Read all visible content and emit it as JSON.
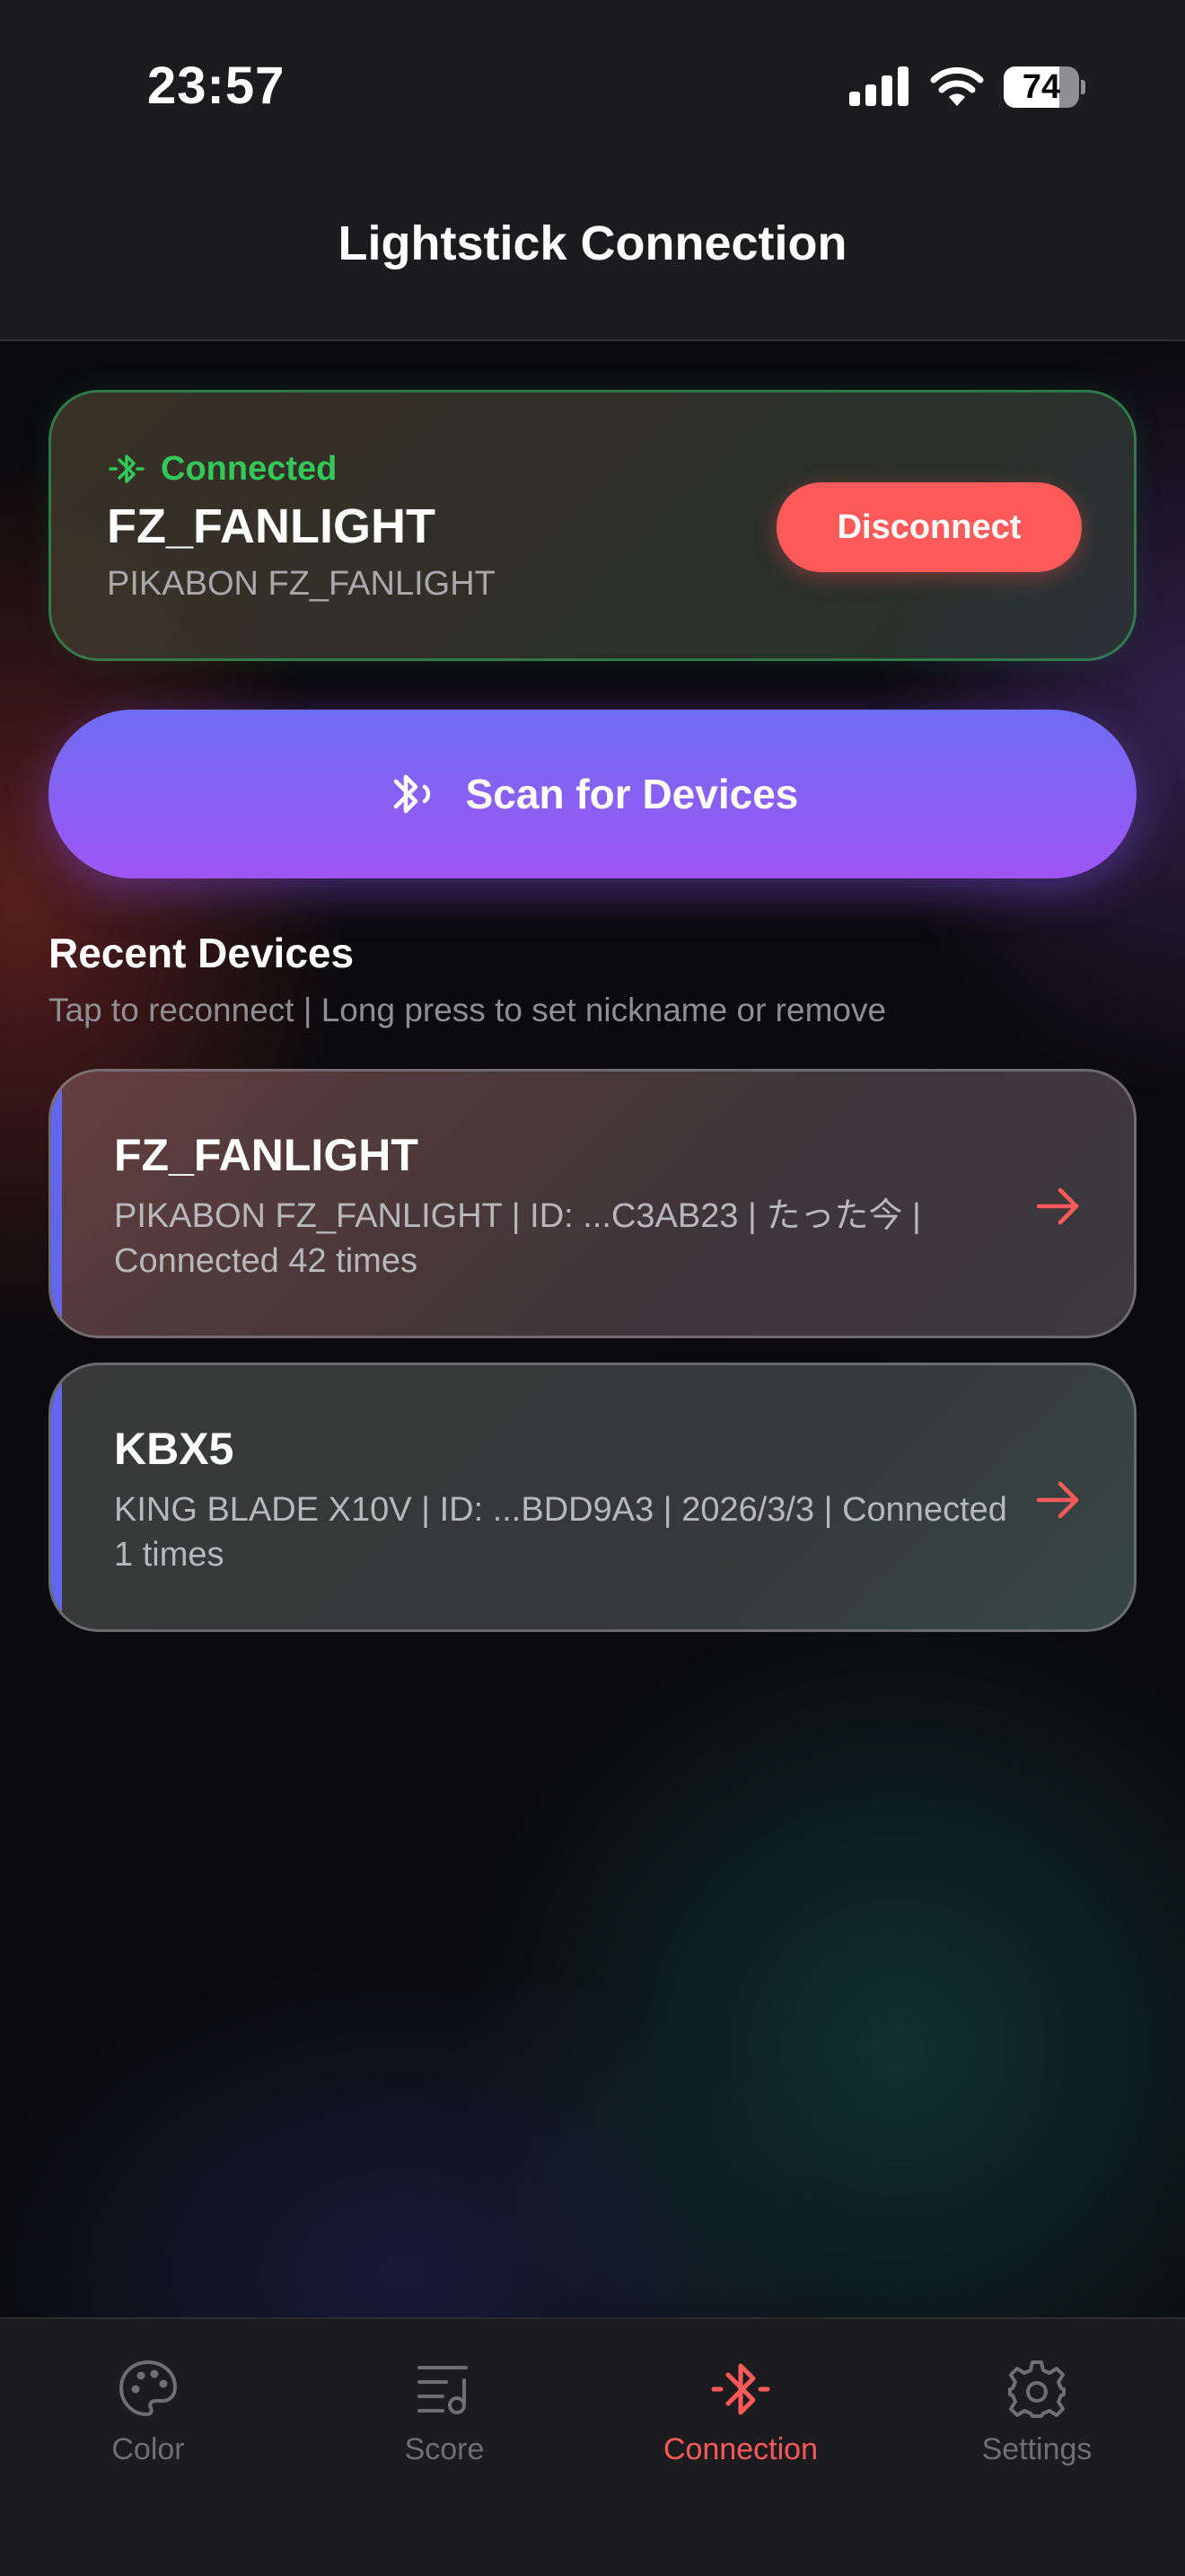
{
  "status_bar": {
    "time": "23:57",
    "battery": "74",
    "battery_level": 0.74
  },
  "header": {
    "title": "Lightstick Connection"
  },
  "connected_device": {
    "status": "Connected",
    "name": "FZ_FANLIGHT",
    "model": "PIKABON FZ_FANLIGHT",
    "disconnect_label": "Disconnect"
  },
  "scan": {
    "label": "Scan for Devices"
  },
  "recent": {
    "title": "Recent Devices",
    "subtitle": "Tap to reconnect | Long press to set nickname or remove",
    "devices": [
      {
        "name": "FZ_FANLIGHT",
        "info": "PIKABON FZ_FANLIGHT | ID: ...C3AB23 | たった今 | Connected 42 times"
      },
      {
        "name": "KBX5",
        "info": "KING BLADE X10V | ID: ...BDD9A3 | 2026/3/3 | Connected 1 times"
      }
    ]
  },
  "tabs": [
    {
      "label": "Color",
      "icon": "palette-icon"
    },
    {
      "label": "Score",
      "icon": "score-icon"
    },
    {
      "label": "Connection",
      "icon": "bluetooth-icon",
      "active": true
    },
    {
      "label": "Settings",
      "icon": "gear-icon"
    }
  ],
  "colors": {
    "accent": "#ff5a5a",
    "connected_green": "#34c759",
    "scan_gradient_start": "#6f6cf2",
    "scan_gradient_end": "#9f56f3",
    "card_accent": "#6366f1"
  }
}
